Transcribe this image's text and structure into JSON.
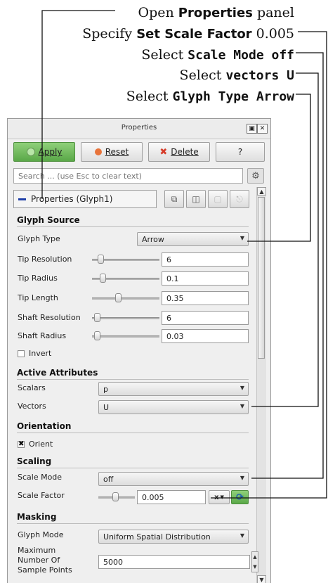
{
  "callouts": {
    "c1": {
      "pre": "Open ",
      "code": "Properties",
      "post": " panel"
    },
    "c2": {
      "pre": "Specify ",
      "code": "Set Scale Factor",
      "post": " 0.005"
    },
    "c3": {
      "pre": "Select ",
      "code": "Scale Mode off",
      "post": ""
    },
    "c4": {
      "pre": "Select ",
      "code": "vectors U",
      "post": ""
    },
    "c5": {
      "pre": "Select ",
      "code": "Glyph Type Arrow",
      "post": ""
    }
  },
  "panel": {
    "title": "Properties",
    "buttons": {
      "apply": "Apply",
      "reset": "Reset",
      "delete": "Delete",
      "help": "?"
    },
    "search_placeholder": "Search ... (use Esc to clear text)",
    "source_label": "Properties (Glyph1)",
    "sections": {
      "glyph_source": "Glyph Source",
      "active_attributes": "Active Attributes",
      "orientation": "Orientation",
      "scaling": "Scaling",
      "masking": "Masking"
    },
    "glyph_source": {
      "glyph_type_label": "Glyph Type",
      "glyph_type_value": "Arrow",
      "tip_resolution_label": "Tip Resolution",
      "tip_resolution_value": "6",
      "tip_radius_label": "Tip Radius",
      "tip_radius_value": "0.1",
      "tip_length_label": "Tip Length",
      "tip_length_value": "0.35",
      "shaft_resolution_label": "Shaft Resolution",
      "shaft_resolution_value": "6",
      "shaft_radius_label": "Shaft Radius",
      "shaft_radius_value": "0.03",
      "invert_label": "Invert"
    },
    "active_attributes": {
      "scalars_label": "Scalars",
      "scalars_value": "p",
      "vectors_label": "Vectors",
      "vectors_value": "U"
    },
    "orientation": {
      "orient_label": "Orient"
    },
    "scaling": {
      "scale_mode_label": "Scale Mode",
      "scale_mode_value": "off",
      "scale_factor_label": "Scale Factor",
      "scale_factor_value": "0.005",
      "x_button": "x"
    },
    "masking": {
      "glyph_mode_label": "Glyph Mode",
      "glyph_mode_value": "Uniform Spatial Distribution",
      "max_points_label": "Maximum Number Of Sample Points",
      "max_points_value": "5000"
    }
  },
  "colors": {
    "apply_green": "#6bb856",
    "reset_orange": "#e8733a",
    "delete_red": "#d63c2a",
    "source_blue": "#1e3ea8"
  }
}
